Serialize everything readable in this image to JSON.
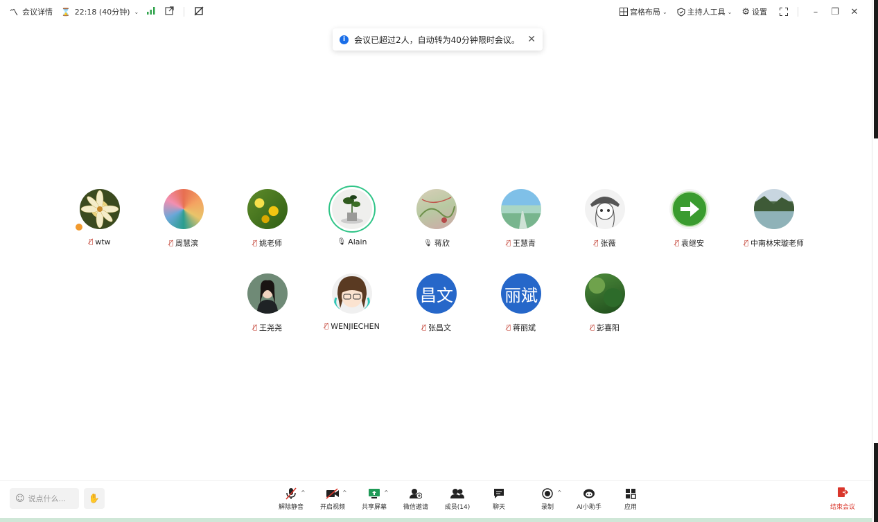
{
  "titlebar": {
    "meeting_details": "会议详情",
    "timer": "22:18 (40分钟)",
    "layout": "宫格布局",
    "host_tools": "主持人工具",
    "settings": "设置"
  },
  "toast": {
    "message": "会议已超过2人，自动转为40分钟限时会议。"
  },
  "participants": [
    {
      "name": "wtw",
      "mic": "muted",
      "avatar": "lily-photo"
    },
    {
      "name": "周慧滨",
      "mic": "muted",
      "avatar": "painting"
    },
    {
      "name": "姚老师",
      "mic": "muted",
      "avatar": "flowers"
    },
    {
      "name": "Alain",
      "mic": "on",
      "avatar": "lotus",
      "speaking": true
    },
    {
      "name": "蒋欣",
      "mic": "on",
      "avatar": "sketch"
    },
    {
      "name": "王慧青",
      "mic": "muted",
      "avatar": "sky-road"
    },
    {
      "name": "张薇",
      "mic": "muted",
      "avatar": "anime-girl"
    },
    {
      "name": "袁继安",
      "mic": "muted",
      "avatar": "green-arrow"
    },
    {
      "name": "中南林宋璇老师",
      "mic": "muted",
      "avatar": "river"
    },
    {
      "name": "王尧尧",
      "mic": "muted",
      "avatar": "woman"
    },
    {
      "name": "WENJIECHEN",
      "mic": "muted",
      "avatar": "anime-boy"
    },
    {
      "name": "张昌文",
      "mic": "muted",
      "avatar_text": "昌文"
    },
    {
      "name": "蒋丽斌",
      "mic": "muted",
      "avatar_text": "丽斌"
    },
    {
      "name": "彭喜阳",
      "mic": "muted",
      "avatar": "forest"
    }
  ],
  "bottombar": {
    "chat_placeholder": "说点什么...",
    "unmute": "解除静音",
    "start_video": "开启视频",
    "share_screen": "共享屏幕",
    "wechat_invite": "微信邀请",
    "members": "成员(14)",
    "chat": "聊天",
    "record": "录制",
    "ai_assistant": "AI小助手",
    "apps": "应用",
    "end_meeting": "结束会议"
  },
  "colors": {
    "accent_blue": "#2667c9",
    "speaking_green": "#2fc487",
    "end_red": "#d9362b"
  }
}
